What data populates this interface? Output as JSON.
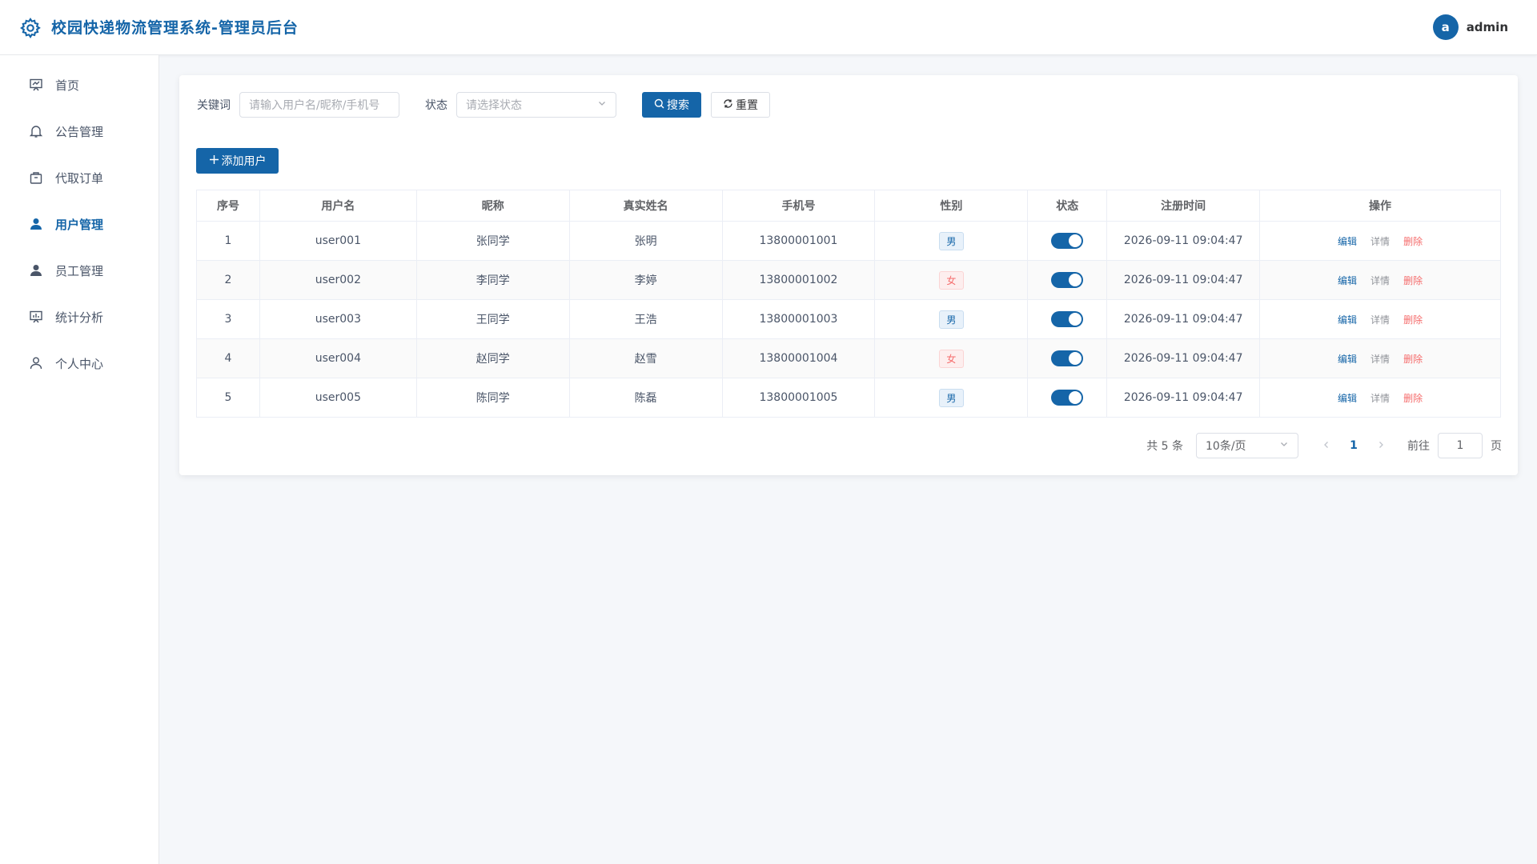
{
  "header": {
    "title": "校园快递物流管理系统-管理员后台",
    "avatar_letter": "a",
    "username": "admin"
  },
  "sidebar": {
    "items": [
      {
        "label": "首页",
        "icon": "presentation-icon",
        "active": false
      },
      {
        "label": "公告管理",
        "icon": "bell-icon",
        "active": false
      },
      {
        "label": "代取订单",
        "icon": "package-icon",
        "active": false
      },
      {
        "label": "用户管理",
        "icon": "user-filled-icon",
        "active": true
      },
      {
        "label": "员工管理",
        "icon": "user-filled-icon",
        "active": false
      },
      {
        "label": "统计分析",
        "icon": "chart-board-icon",
        "active": false
      },
      {
        "label": "个人中心",
        "icon": "user-outline-icon",
        "active": false
      }
    ]
  },
  "search": {
    "keyword_label": "关键词",
    "keyword_placeholder": "请输入用户名/昵称/手机号",
    "status_label": "状态",
    "status_placeholder": "请选择状态",
    "search_button": "搜索",
    "reset_button": "重置"
  },
  "toolbar": {
    "add_button": "添加用户"
  },
  "table": {
    "columns": [
      "序号",
      "用户名",
      "昵称",
      "真实姓名",
      "手机号",
      "性别",
      "状态",
      "注册时间",
      "操作"
    ],
    "rows": [
      {
        "index": "1",
        "username": "user001",
        "nickname": "张同学",
        "real_name": "张明",
        "phone": "13800001001",
        "gender": "男",
        "status_on": true,
        "registered": "2026-09-11 09:04:47"
      },
      {
        "index": "2",
        "username": "user002",
        "nickname": "李同学",
        "real_name": "李婷",
        "phone": "13800001002",
        "gender": "女",
        "status_on": true,
        "registered": "2026-09-11 09:04:47"
      },
      {
        "index": "3",
        "username": "user003",
        "nickname": "王同学",
        "real_name": "王浩",
        "phone": "13800001003",
        "gender": "男",
        "status_on": true,
        "registered": "2026-09-11 09:04:47"
      },
      {
        "index": "4",
        "username": "user004",
        "nickname": "赵同学",
        "real_name": "赵雪",
        "phone": "13800001004",
        "gender": "女",
        "status_on": true,
        "registered": "2026-09-11 09:04:47"
      },
      {
        "index": "5",
        "username": "user005",
        "nickname": "陈同学",
        "real_name": "陈磊",
        "phone": "13800001005",
        "gender": "男",
        "status_on": true,
        "registered": "2026-09-11 09:04:47"
      }
    ],
    "actions": {
      "edit": "编辑",
      "detail": "详情",
      "delete": "删除"
    }
  },
  "pagination": {
    "total": "共 5 条",
    "page_size": "10条/页",
    "current_page": "1",
    "goto_label": "前往",
    "goto_value": "1",
    "page_suffix": "页"
  },
  "colors": {
    "primary": "#1565a8",
    "danger": "#f56c6c",
    "background": "#f5f7fa"
  }
}
